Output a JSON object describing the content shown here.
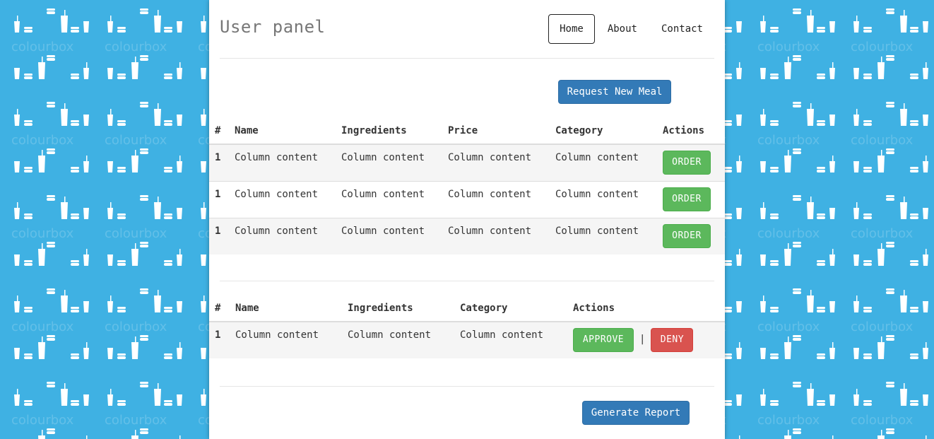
{
  "colors": {
    "background": "#3fb1e3",
    "primary": "#337ab7",
    "success": "#5cb85c",
    "danger": "#d9534f"
  },
  "background_pattern": {
    "icons": [
      "drink-cup-icon",
      "burger-icon"
    ],
    "watermark": "colourbox"
  },
  "header": {
    "title": "User panel",
    "nav": [
      {
        "label": "Home",
        "active": true
      },
      {
        "label": "About",
        "active": false
      },
      {
        "label": "Contact",
        "active": false
      }
    ]
  },
  "request_button": "Request New Meal",
  "meals": {
    "columns": [
      "#",
      "Name",
      "Ingredients",
      "Price",
      "Category",
      "Actions"
    ],
    "rows": [
      {
        "num": "1",
        "name": "Column content",
        "ingredients": "Column content",
        "price": "Column content",
        "category": "Column content",
        "action": "ORDER"
      },
      {
        "num": "1",
        "name": "Column content",
        "ingredients": "Column content",
        "price": "Column content",
        "category": "Column content",
        "action": "ORDER"
      },
      {
        "num": "1",
        "name": "Column content",
        "ingredients": "Column content",
        "price": "Column content",
        "category": "Column content",
        "action": "ORDER"
      }
    ]
  },
  "requests": {
    "columns": [
      "#",
      "Name",
      "Ingredients",
      "Category",
      "Actions"
    ],
    "rows": [
      {
        "num": "1",
        "name": "Column content",
        "ingredients": "Column content",
        "category": "Column content",
        "approve": "APPROVE",
        "separator": "|",
        "deny": "DENY"
      }
    ]
  },
  "report_button": "Generate Report"
}
